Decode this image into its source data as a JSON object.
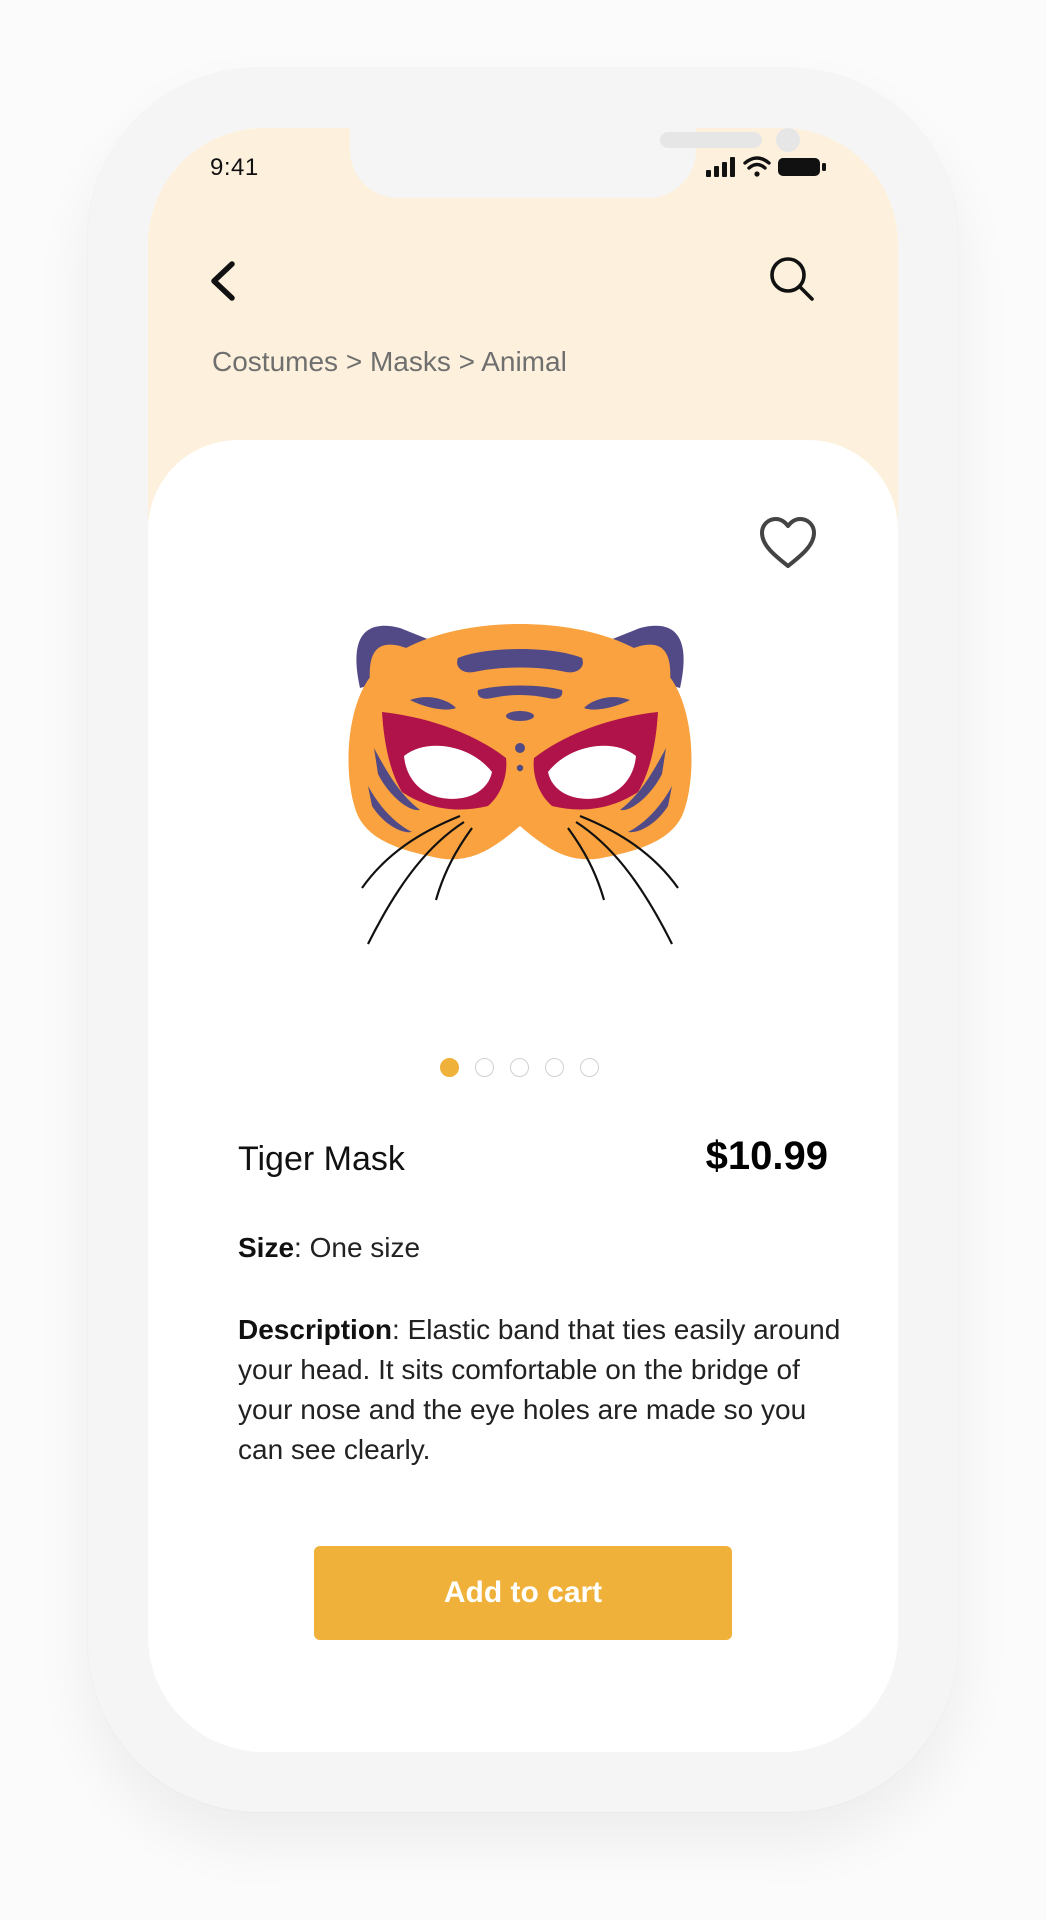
{
  "status_bar": {
    "time": "9:41"
  },
  "nav": {
    "back_icon": "chevron-left-icon",
    "search_icon": "search-icon"
  },
  "breadcrumb": {
    "text": "Costumes > Masks > Animal"
  },
  "product": {
    "favorite_icon": "heart-outline-icon",
    "name": "Tiger Mask",
    "price": "$10.99",
    "size_label": "Size",
    "size_value": "One size",
    "description_label": "Description",
    "description_text": "Elastic band that ties easily around your head. It sits comfortable on the bridge of your nose and the eye holes are made so you can see clearly."
  },
  "carousel": {
    "count": 5,
    "active_index": 0
  },
  "actions": {
    "add_to_cart_label": "Add to cart"
  },
  "colors": {
    "header_bg": "#fdf1dd",
    "accent": "#efb139",
    "mask_orange": "#f9a23f",
    "mask_purple": "#524a86",
    "mask_magenta": "#b0124a"
  }
}
